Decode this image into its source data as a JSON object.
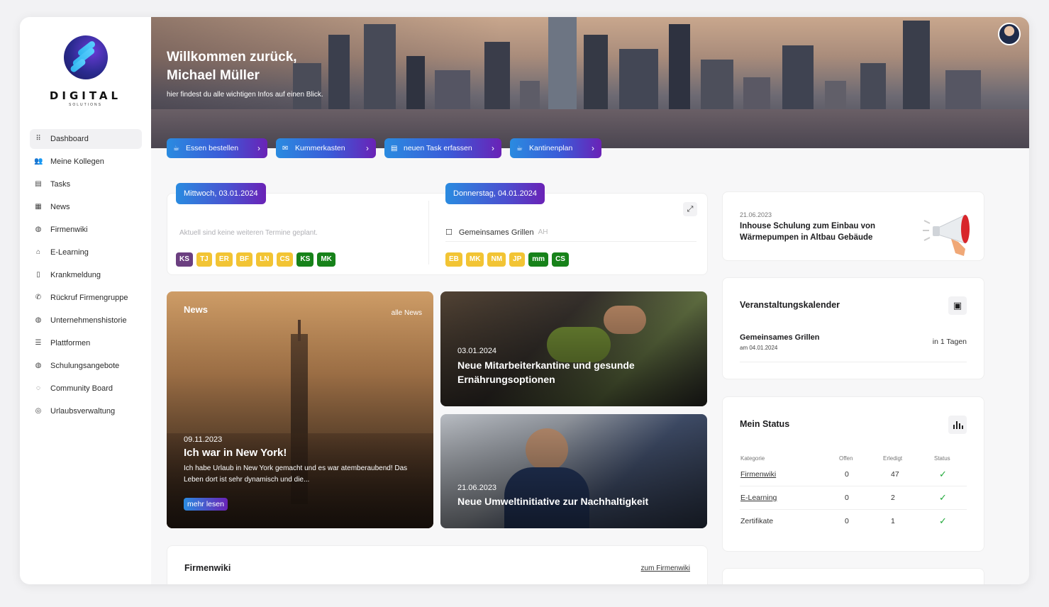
{
  "brand": {
    "name": "DIGITAL",
    "tagline": "SOLUTIONS"
  },
  "sidebar": {
    "items": [
      {
        "label": "Dashboard",
        "icon": "grid-icon",
        "glyph": "⠿",
        "active": true
      },
      {
        "label": "Meine Kollegen",
        "icon": "people-icon",
        "glyph": "👥"
      },
      {
        "label": "Tasks",
        "icon": "task-icon",
        "glyph": "▤"
      },
      {
        "label": "News",
        "icon": "newspaper-icon",
        "glyph": "▦"
      },
      {
        "label": "Firmenwiki",
        "icon": "globe-icon",
        "glyph": "◍"
      },
      {
        "label": "E-Learning",
        "icon": "graduation-cap-icon",
        "glyph": "⌂"
      },
      {
        "label": "Krankmeldung",
        "icon": "document-icon",
        "glyph": "▯"
      },
      {
        "label": "Rückruf Firmengruppe",
        "icon": "phone-icon",
        "glyph": "✆"
      },
      {
        "label": "Unternehmenshistorie",
        "icon": "globe-icon",
        "glyph": "◍"
      },
      {
        "label": "Plattformen",
        "icon": "server-icon",
        "glyph": "☰"
      },
      {
        "label": "Schulungsangebote",
        "icon": "globe-icon",
        "glyph": "◍"
      },
      {
        "label": "Community Board",
        "icon": "chat-icon",
        "glyph": "◌"
      },
      {
        "label": "Urlaubsverwaltung",
        "icon": "compass-icon",
        "glyph": "◎"
      }
    ]
  },
  "hero": {
    "title_line1": "Willkommen zurück,",
    "title_line2": "Michael Müller",
    "subtitle": "hier findest du alle wichtigen Infos auf einen Blick."
  },
  "quick_actions": [
    {
      "label": "Essen bestellen",
      "icon": "food-icon"
    },
    {
      "label": "Kummerkasten",
      "icon": "chat-bubble-icon"
    },
    {
      "label": "neuen Task erfassen",
      "icon": "task-icon"
    },
    {
      "label": "Kantinenplan",
      "icon": "food-icon"
    }
  ],
  "calendar": {
    "day1": {
      "date": "Mittwoch, 03.01.2024",
      "note": "Aktuell sind keine weiteren Termine geplant.",
      "badges": [
        {
          "text": "KS",
          "color": "#6b3f80"
        },
        {
          "text": "TJ",
          "color": "#f2c434"
        },
        {
          "text": "ER",
          "color": "#f2c434"
        },
        {
          "text": "BF",
          "color": "#f2c434"
        },
        {
          "text": "LN",
          "color": "#f2c434"
        },
        {
          "text": "CS",
          "color": "#f2c434"
        },
        {
          "text": "KS",
          "color": "#17821a"
        },
        {
          "text": "MK",
          "color": "#17821a"
        }
      ]
    },
    "day2": {
      "date": "Donnerstag, 04.01.2024",
      "event": "Gemeinsames Grillen",
      "event_tag": "AH",
      "badges": [
        {
          "text": "EB",
          "color": "#f2c434"
        },
        {
          "text": "MK",
          "color": "#f2c434"
        },
        {
          "text": "NM",
          "color": "#f2c434"
        },
        {
          "text": "JP",
          "color": "#f2c434"
        },
        {
          "text": "mm",
          "color": "#17821a"
        },
        {
          "text": "CS",
          "color": "#17821a"
        }
      ]
    }
  },
  "news": {
    "heading": "News",
    "all_link": "alle News",
    "featured": {
      "date": "09.11.2023",
      "title": "Ich war in New York!",
      "teaser": "Ich habe Urlaub in New York gemacht und es war atemberaubend! Das Leben dort ist sehr dynamisch und die...",
      "more": "mehr lesen"
    },
    "item1": {
      "date": "03.01.2024",
      "title": "Neue Mitarbeiterkantine und gesunde Ernährungsoptionen"
    },
    "item2": {
      "date": "21.06.2023",
      "title": "Neue Umweltinitiative zur Nachhaltigkeit"
    }
  },
  "firmenwiki": {
    "title": "Firmenwiki",
    "link": "zum Firmenwiki"
  },
  "announcement": {
    "date": "21.06.2023",
    "title": "Inhouse Schulung zum Einbau von Wärmepumpen in Altbau Gebäude"
  },
  "events": {
    "title": "Veranstaltungskalender",
    "item": {
      "name": "Gemeinsames Grillen",
      "date": "am 04.01.2024",
      "when": "in 1 Tagen"
    }
  },
  "status": {
    "title": "Mein Status",
    "headers": [
      "Kategorie",
      "Offen",
      "Erledigt",
      "Status"
    ],
    "rows": [
      {
        "category": "Firmenwiki",
        "open": "0",
        "done": "47",
        "link": true
      },
      {
        "category": "E-Learning",
        "open": "0",
        "done": "2",
        "link": true
      },
      {
        "category": "Zertifikate",
        "open": "0",
        "done": "1",
        "link": false
      }
    ]
  }
}
